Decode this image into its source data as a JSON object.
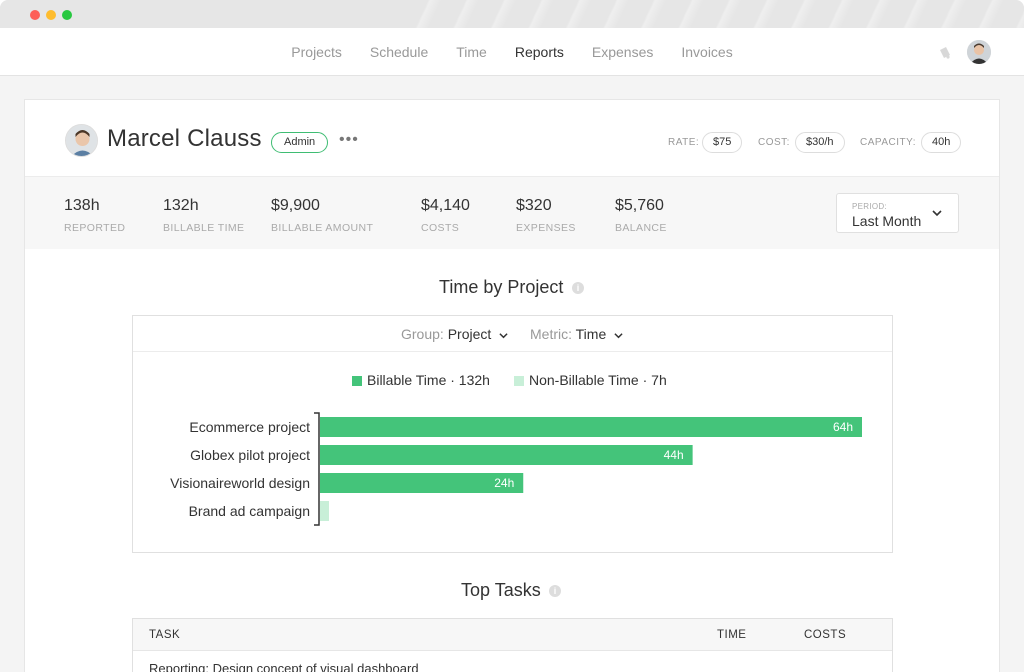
{
  "nav": {
    "items": [
      "Projects",
      "Schedule",
      "Time",
      "Reports",
      "Expenses",
      "Invoices"
    ],
    "active": "Reports"
  },
  "profile": {
    "name": "Marcel Clauss",
    "role": "Admin",
    "rate_label": "RATE:",
    "rate": "$75",
    "cost_label": "COST:",
    "cost": "$30/h",
    "capacity_label": "CAPACITY:",
    "capacity": "40h"
  },
  "stats": [
    {
      "value": "138h",
      "label": "REPORTED"
    },
    {
      "value": "132h",
      "label": "BILLABLE TIME"
    },
    {
      "value": "$9,900",
      "label": "BILLABLE AMOUNT"
    },
    {
      "value": "$4,140",
      "label": "COSTS"
    },
    {
      "value": "$320",
      "label": "EXPENSES"
    },
    {
      "value": "$5,760",
      "label": "BALANCE"
    }
  ],
  "period": {
    "label": "PERIOD:",
    "value": "Last Month"
  },
  "time_by_project": {
    "title": "Time by Project",
    "group_label": "Group:",
    "group_value": "Project",
    "metric_label": "Metric:",
    "metric_value": "Time"
  },
  "colors": {
    "billable": "#44c47a",
    "non_billable": "#c8efd8",
    "accent": "#3fbd73"
  },
  "chart_data": {
    "type": "bar",
    "orientation": "horizontal",
    "categories": [
      "Ecommerce project",
      "Globex pilot project",
      "Visionaireworld design",
      "Brand ad campaign"
    ],
    "series": [
      {
        "name": "Billable Time · 132h",
        "values": [
          64,
          44,
          24,
          0
        ],
        "labels": [
          "64h",
          "44h",
          "24h",
          ""
        ]
      },
      {
        "name": "Non-Billable Time · 7h",
        "values": [
          0,
          0,
          0,
          1
        ],
        "labels": [
          "",
          "",
          "",
          ""
        ]
      }
    ],
    "xlim": [
      0,
      64
    ],
    "legend": "top-center",
    "grid": false
  },
  "top_tasks": {
    "title": "Top Tasks",
    "columns": [
      "TASK",
      "TIME",
      "COSTS"
    ],
    "rows": [
      {
        "task": "Reporting: Design concept of visual dashboard"
      }
    ]
  }
}
